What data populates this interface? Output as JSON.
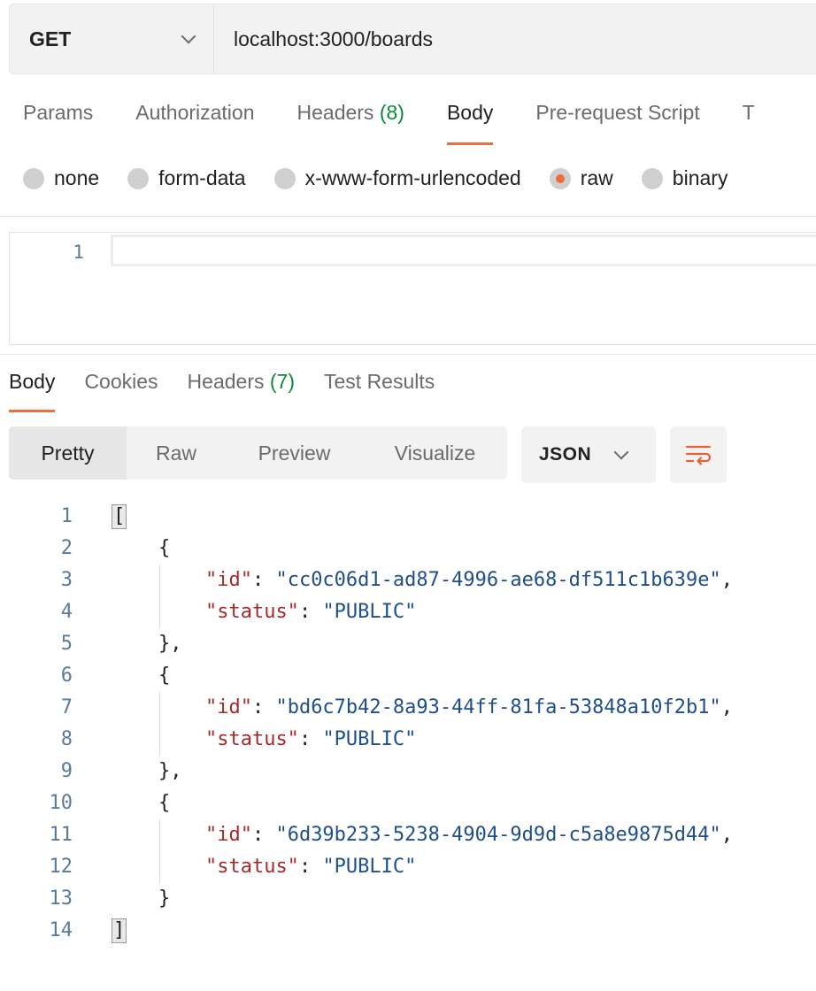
{
  "request": {
    "method": "GET",
    "url": "localhost:3000/boards"
  },
  "request_tabs": [
    {
      "label": "Params"
    },
    {
      "label": "Authorization"
    },
    {
      "label": "Headers",
      "count": "(8)"
    },
    {
      "label": "Body"
    },
    {
      "label": "Pre-request Script"
    },
    {
      "label": "T"
    }
  ],
  "body_modes": [
    "none",
    "form-data",
    "x-www-form-urlencoded",
    "raw",
    "binary"
  ],
  "request_editor": {
    "line": "1"
  },
  "response_tabs": [
    {
      "label": "Body"
    },
    {
      "label": "Cookies"
    },
    {
      "label": "Headers",
      "count": "(7)"
    },
    {
      "label": "Test Results"
    }
  ],
  "view_modes": [
    "Pretty",
    "Raw",
    "Preview",
    "Visualize"
  ],
  "format": "JSON",
  "response_lines": {
    "n": [
      "1",
      "2",
      "3",
      "4",
      "5",
      "6",
      "7",
      "8",
      "9",
      "10",
      "11",
      "12",
      "13",
      "14"
    ],
    "open_array": "[",
    "close_array": "]",
    "open_obj": "{",
    "close_obj_comma": "},",
    "close_obj": "}",
    "key_id": "\"id\"",
    "key_status": "\"status\"",
    "colon": ": ",
    "comma": ",",
    "id1": "\"cc0c06d1-ad87-4996-ae68-df511c1b639e\"",
    "id2": "\"bd6c7b42-8a93-44ff-81fa-53848a10f2b1\"",
    "id3": "\"6d39b233-5238-4904-9d9d-c5a8e9875d44\"",
    "status_val": "\"PUBLIC\""
  }
}
